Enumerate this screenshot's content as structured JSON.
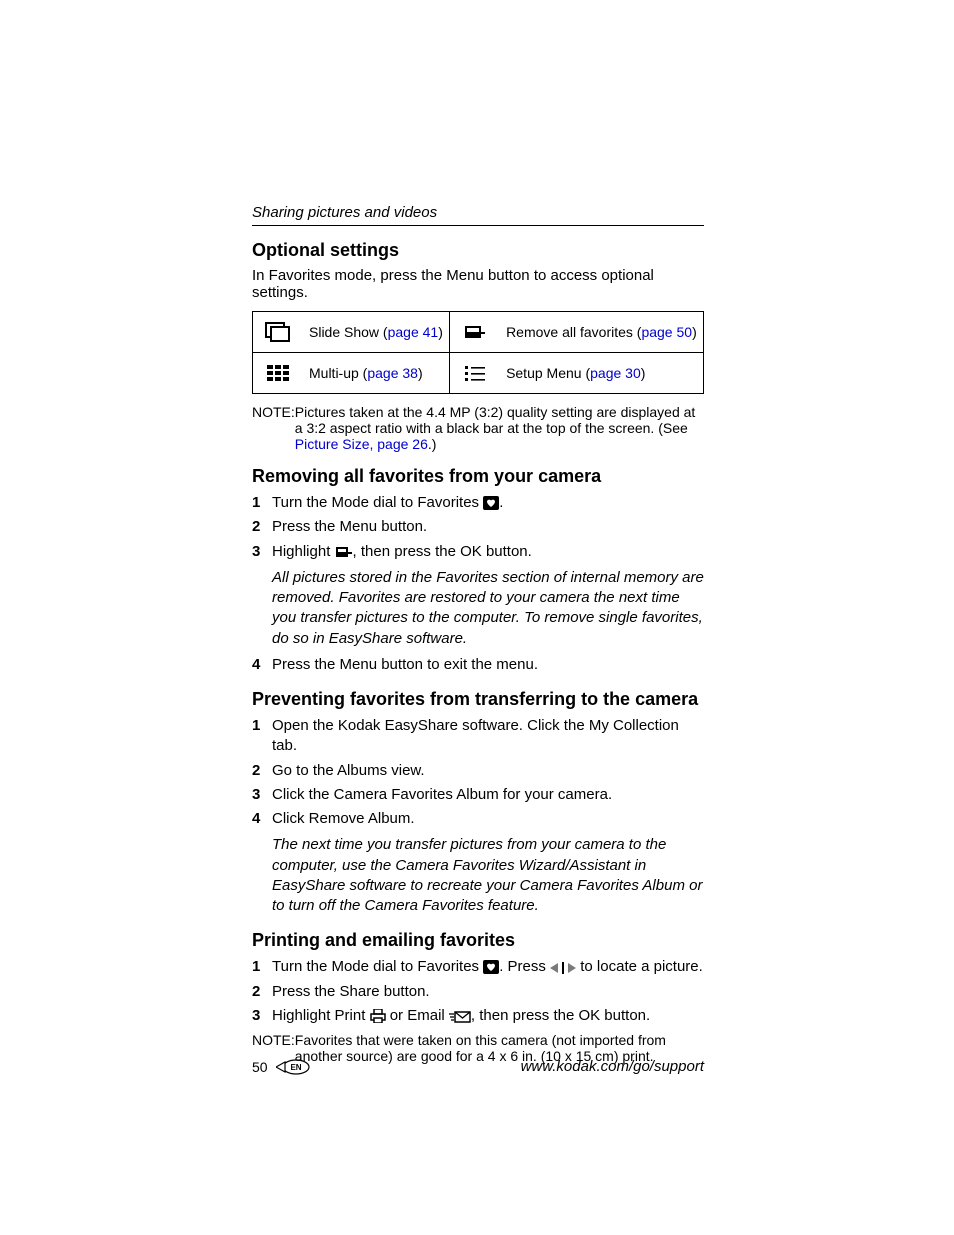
{
  "running_head": "Sharing pictures and videos",
  "sections": {
    "optional": {
      "title": "Optional settings",
      "lead": "In Favorites mode, press the Menu button to access optional settings.",
      "table": {
        "r1c1": {
          "label": "Slide Show (",
          "link": "page 41",
          "tail": ")"
        },
        "r1c2": {
          "label": "Remove all favorites (",
          "link": "page 50",
          "tail": ")"
        },
        "r2c1": {
          "label": "Multi-up (",
          "link": "page 38",
          "tail": ")"
        },
        "r2c2": {
          "label": "Setup Menu (",
          "link": "page 30",
          "tail": ")"
        }
      },
      "note_label": "NOTE:",
      "note_text_a": "Pictures taken at the 4.4 MP (3:2) quality setting are displayed at a 3:2 aspect ratio with a black bar at the top of the screen. (See ",
      "note_link": "Picture Size, page 26",
      "note_text_b": ".)"
    },
    "removing": {
      "title": "Removing all favorites from your camera",
      "step1a": "Turn the Mode dial to Favorites ",
      "step1b": ".",
      "step2": "Press the Menu button.",
      "step3a": "Highlight ",
      "step3b": ", then press the OK button.",
      "result": "All pictures stored in the Favorites section of internal memory are removed. Favorites are restored to your camera the next time you transfer pictures to the computer. To remove single favorites, do so in EasyShare software.",
      "step4": "Press the Menu button to exit the menu."
    },
    "preventing": {
      "title": "Preventing favorites from transferring to the camera",
      "step1": "Open the Kodak EasyShare software. Click the My Collection tab.",
      "step2": "Go to the Albums view.",
      "step3": "Click the Camera Favorites Album for your camera.",
      "step4": "Click Remove Album.",
      "result": "The next time you transfer pictures from your camera to the computer, use the Camera Favorites Wizard/Assistant in EasyShare software to recreate your Camera Favorites Album or to turn off the Camera Favorites feature."
    },
    "printing": {
      "title": "Printing and emailing favorites",
      "step1a": "Turn the Mode dial to Favorites ",
      "step1b": ". Press ",
      "step1c": " to locate a picture.",
      "step2": "Press the Share button.",
      "step3a": "Highlight Print ",
      "step3b": " or Email ",
      "step3c": ", then press the OK button.",
      "note_label": "NOTE:",
      "note_text": "Favorites that were taken on this camera (not imported from another source) are good for a 4 x 6 in. (10 x 15 cm) print."
    }
  },
  "footer": {
    "page_number": "50",
    "lang": "EN",
    "url": "www.kodak.com/go/support"
  }
}
